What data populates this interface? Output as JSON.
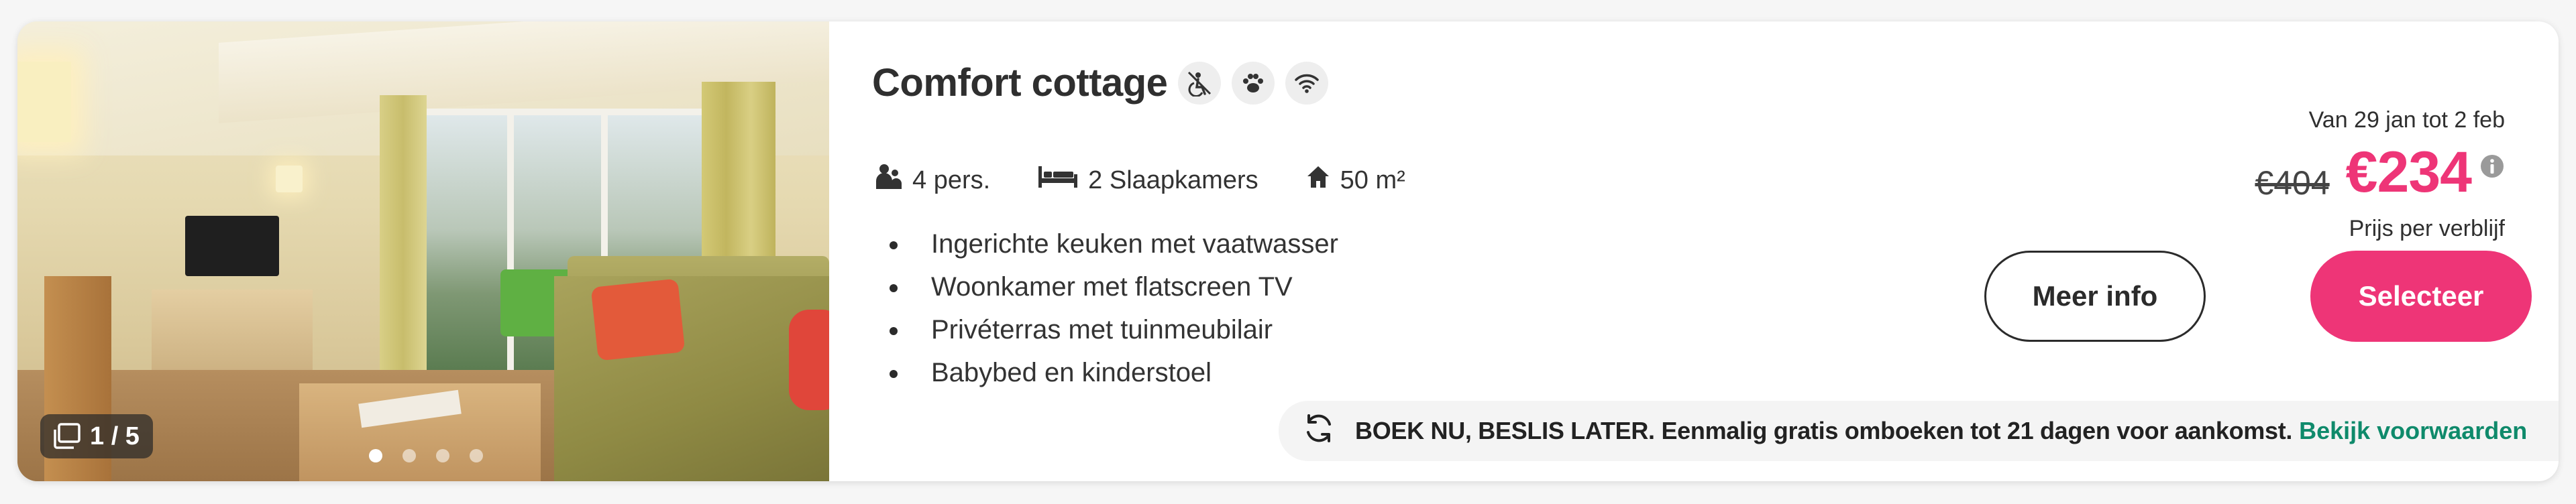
{
  "listing": {
    "title": "Comfort cottage",
    "feature_icons": [
      "no-smoking-icon",
      "pet-paw-icon",
      "wifi-icon"
    ],
    "photo": {
      "counter_text": "1 / 5",
      "counter_icon": "gallery-icon",
      "dots_total": 4,
      "dot_active": 1
    },
    "specs": [
      {
        "icon": "persons-icon",
        "label": "4 pers."
      },
      {
        "icon": "bed-icon",
        "label": "2 Slaapkamers"
      },
      {
        "icon": "house-icon",
        "label": "50 m²"
      }
    ],
    "bullets": [
      "Ingerichte keuken met vaatwasser",
      "Woonkamer met flatscreen TV",
      "Privéterras met tuinmeubilair",
      "Babybed en kinderstoel"
    ],
    "pricing": {
      "dates": "Van 29 jan tot 2 feb",
      "old_price": "€404",
      "new_price": "€234",
      "note": "Prijs per verblijf",
      "info_icon": "info-icon"
    },
    "buttons": {
      "info_label": "Meer info",
      "select_label": "Selecteer"
    },
    "banner": {
      "icon": "sync-icon",
      "text": "BOEK NU, BESLIS LATER. Eenmalig gratis omboeken tot 21 dagen voor aankomst.",
      "link": "Bekijk voorwaarden"
    }
  },
  "colors": {
    "accent": "#ee3577",
    "link": "#0f8a6b",
    "text": "#2b2b2b",
    "banner_bg": "#f4f4f4"
  }
}
